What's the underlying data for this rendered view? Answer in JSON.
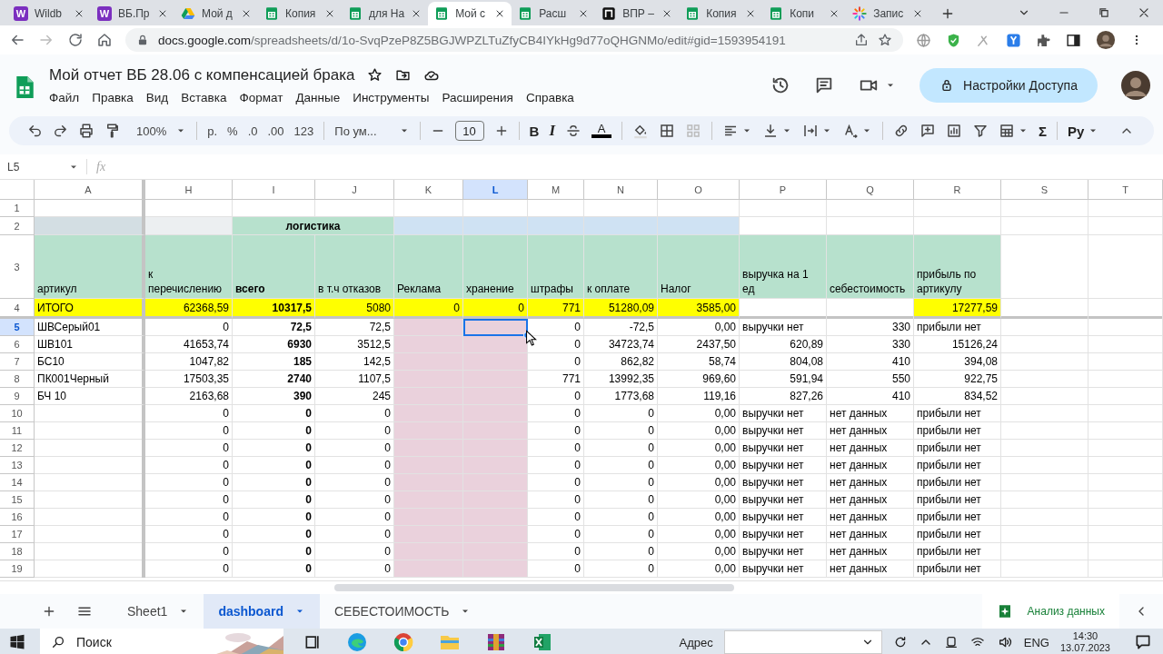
{
  "browser": {
    "tabs": [
      {
        "title": "Wildb",
        "kind": "badge",
        "badge": "W",
        "selected": false
      },
      {
        "title": "ВБ.Пр",
        "kind": "badge",
        "badge": "W",
        "selected": false
      },
      {
        "title": "Мой д",
        "kind": "drive",
        "selected": false
      },
      {
        "title": "Копия",
        "kind": "sheets",
        "selected": false
      },
      {
        "title": "для На",
        "kind": "sheets",
        "selected": false
      },
      {
        "title": "Мой с",
        "kind": "sheets",
        "selected": true
      },
      {
        "title": "Расш",
        "kind": "sheets",
        "selected": false
      },
      {
        "title": "ВПР –",
        "kind": "dark",
        "selected": false
      },
      {
        "title": "Копия",
        "kind": "sheets",
        "selected": false
      },
      {
        "title": "Копи",
        "kind": "sheets",
        "selected": false
      },
      {
        "title": "Запис",
        "kind": "spinner",
        "selected": false
      }
    ],
    "url_host": "docs.google.com",
    "url_path": "/spreadsheets/d/1o-SvqPzeP8Z5BGJWPZLTuZfyCB4IYkHg9d77oQHGNMo/edit#gid=1593954191"
  },
  "doc": {
    "title": "Мой отчет ВБ 28.06 с компенсацией брака",
    "menu": [
      "Файл",
      "Правка",
      "Вид",
      "Вставка",
      "Формат",
      "Данные",
      "Инструменты",
      "Расширения",
      "Справка"
    ],
    "share": "Настройки Доступа"
  },
  "toolbar": {
    "zoom": "100%",
    "currency": "р.",
    "percent": "%",
    "decrease_decimals": ".0",
    "increase_decimals": ".00",
    "number_format": "123",
    "font": "По ум...",
    "font_size": "10",
    "bold": "B",
    "italic": "I",
    "text_color": "A",
    "sum": "Σ",
    "input_tools": "Ру"
  },
  "formula_bar": {
    "cell": "L5",
    "fx": "fx"
  },
  "sheet": {
    "columns": [
      {
        "label": "A",
        "selected": false,
        "bold": false
      },
      {
        "label": "H",
        "selected": false,
        "bold": false
      },
      {
        "label": "I",
        "selected": false,
        "bold": true
      },
      {
        "label": "J",
        "selected": false,
        "bold": false
      },
      {
        "label": "K",
        "selected": false,
        "bold": false
      },
      {
        "label": "L",
        "selected": true,
        "bold": false
      },
      {
        "label": "M",
        "selected": false,
        "bold": false
      },
      {
        "label": "N",
        "selected": false,
        "bold": false
      },
      {
        "label": "O",
        "selected": false,
        "bold": false
      },
      {
        "label": "P",
        "selected": false,
        "bold": false
      },
      {
        "label": "Q",
        "selected": false,
        "bold": false
      },
      {
        "label": "R",
        "selected": false,
        "bold": false
      },
      {
        "label": "S",
        "selected": false
      },
      {
        "label": "T",
        "selected": false
      }
    ],
    "rows": [
      {
        "number": "1",
        "selected": false,
        "cells": {}
      },
      {
        "number": "2",
        "selected": false,
        "cells": {
          "A": {
            "color": "#d3dee3"
          },
          "H": {
            "color": "#eceff1"
          },
          "I": {
            "text": "логистика",
            "color": "#b7e1cd",
            "merged": true
          },
          "K": {
            "color": "#cfe2f3"
          },
          "L": {
            "color": "#cfe2f3"
          },
          "M": {
            "color": "#cfe2f3"
          },
          "N": {
            "color": "#cfe2f3"
          },
          "O": {
            "color": "#cfe2f3"
          }
        }
      },
      {
        "number": "3",
        "selected": false,
        "cells": {
          "A": {
            "text": "артикул",
            "color": "#b7e1cd"
          },
          "H": {
            "text": "к перечислению",
            "color": "#b7e1cd"
          },
          "I": {
            "text": "всего",
            "color": "#b7e1cd"
          },
          "J": {
            "text": "в т.ч отказов",
            "color": "#b7e1cd"
          },
          "K": {
            "text": "Реклама",
            "color": "#b7e1cd"
          },
          "L": {
            "text": "хранение",
            "color": "#b7e1cd"
          },
          "M": {
            "text": "штрафы",
            "color": "#b7e1cd"
          },
          "N": {
            "text": "к оплате",
            "color": "#b7e1cd"
          },
          "O": {
            "text": "Налог",
            "color": "#b7e1cd"
          },
          "P": {
            "text": "выручка на 1 ед",
            "color": "#b7e1cd"
          },
          "Q": {
            "text": "себестоимость",
            "color": "#b7e1cd"
          },
          "R": {
            "text": "прибыль по артикулу",
            "color": "#b7e1cd"
          }
        }
      },
      {
        "number": "4",
        "selected": false,
        "cells": {
          "A": {
            "text": "ИТОГО",
            "color": "#ffff00"
          },
          "H": {
            "text": "62368,59",
            "color": "#ffff00"
          },
          "I": {
            "text": "10317,5",
            "color": "#ffff00"
          },
          "J": {
            "text": "5080",
            "color": "#ffff00"
          },
          "K": {
            "text": "0",
            "color": "#ffff00"
          },
          "L": {
            "text": "0",
            "color": "#ffff00"
          },
          "M": {
            "text": "771",
            "color": "#ffff00"
          },
          "N": {
            "text": "51280,09",
            "color": "#ffff00"
          },
          "O": {
            "text": "3585,00",
            "color": "#ffff00"
          },
          "R": {
            "text": "17277,59",
            "color": "#ffff00"
          }
        }
      },
      {
        "number": "5",
        "selected": true,
        "cells": {
          "A": "ШВСерый01",
          "H": "0",
          "I": "72,5",
          "J": "72,5",
          "K": {
            "color": "#ead1dc"
          },
          "L": {
            "color": "#ead1dc",
            "selected": true
          },
          "M": "0",
          "N": "-72,5",
          "O": "0,00",
          "P": "выручки нет",
          "Q": "330",
          "R": "прибыли нет"
        }
      },
      {
        "number": "6",
        "selected": false,
        "cells": {
          "A": "ШВ101",
          "H": "41653,74",
          "I": "6930",
          "J": "3512,5",
          "K": {
            "color": "#ead1dc"
          },
          "L": {
            "color": "#ead1dc"
          },
          "M": "0",
          "N": "34723,74",
          "O": "2437,50",
          "P": "620,89",
          "Q": "330",
          "R": "15126,24"
        }
      },
      {
        "number": "7",
        "selected": false,
        "cells": {
          "A": "БС10",
          "H": "1047,82",
          "I": "185",
          "J": "142,5",
          "K": {
            "color": "#ead1dc"
          },
          "L": {
            "color": "#ead1dc"
          },
          "M": "0",
          "N": "862,82",
          "O": "58,74",
          "P": "804,08",
          "Q": "410",
          "R": "394,08"
        }
      },
      {
        "number": "8",
        "selected": false,
        "cells": {
          "A": "ПК001Черный",
          "H": "17503,35",
          "I": "2740",
          "J": "1107,5",
          "K": {
            "color": "#ead1dc"
          },
          "L": {
            "color": "#ead1dc"
          },
          "M": "771",
          "N": "13992,35",
          "O": "969,60",
          "P": "591,94",
          "Q": "550",
          "R": "922,75"
        }
      },
      {
        "number": "9",
        "selected": false,
        "cells": {
          "A": "БЧ 10",
          "H": "2163,68",
          "I": "390",
          "J": "245",
          "K": {
            "color": "#ead1dc"
          },
          "L": {
            "color": "#ead1dc"
          },
          "M": "0",
          "N": "1773,68",
          "O": "119,16",
          "P": "827,26",
          "Q": "410",
          "R": "834,52"
        }
      },
      {
        "number": "10",
        "selected": false,
        "cells": {
          "H": "0",
          "I": "0",
          "J": "0",
          "K": {
            "color": "#ead1dc"
          },
          "L": {
            "color": "#ead1dc"
          },
          "M": "0",
          "N": "0",
          "O": "0,00",
          "P": "выручки нет",
          "Q": "нет данных",
          "R": "прибыли нет"
        }
      },
      {
        "number": "11",
        "selected": false,
        "cells": {
          "H": "0",
          "I": "0",
          "J": "0",
          "K": {
            "color": "#ead1dc"
          },
          "L": {
            "color": "#ead1dc"
          },
          "M": "0",
          "N": "0",
          "O": "0,00",
          "P": "выручки нет",
          "Q": "нет данных",
          "R": "прибыли нет"
        }
      },
      {
        "number": "12",
        "selected": false,
        "cells": {
          "H": "0",
          "I": "0",
          "J": "0",
          "K": {
            "color": "#ead1dc"
          },
          "L": {
            "color": "#ead1dc"
          },
          "M": "0",
          "N": "0",
          "O": "0,00",
          "P": "выручки нет",
          "Q": "нет данных",
          "R": "прибыли нет"
        }
      },
      {
        "number": "13",
        "selected": false,
        "cells": {
          "H": "0",
          "I": "0",
          "J": "0",
          "K": {
            "color": "#ead1dc"
          },
          "L": {
            "color": "#ead1dc"
          },
          "M": "0",
          "N": "0",
          "O": "0,00",
          "P": "выручки нет",
          "Q": "нет данных",
          "R": "прибыли нет"
        }
      },
      {
        "number": "14",
        "selected": false,
        "cells": {
          "H": "0",
          "I": "0",
          "J": "0",
          "K": {
            "color": "#ead1dc"
          },
          "L": {
            "color": "#ead1dc"
          },
          "M": "0",
          "N": "0",
          "O": "0,00",
          "P": "выручки нет",
          "Q": "нет данных",
          "R": "прибыли нет"
        }
      },
      {
        "number": "15",
        "selected": false,
        "cells": {
          "H": "0",
          "I": "0",
          "J": "0",
          "K": {
            "color": "#ead1dc"
          },
          "L": {
            "color": "#ead1dc"
          },
          "M": "0",
          "N": "0",
          "O": "0,00",
          "P": "выручки нет",
          "Q": "нет данных",
          "R": "прибыли нет"
        }
      },
      {
        "number": "16",
        "selected": false,
        "cells": {
          "H": "0",
          "I": "0",
          "J": "0",
          "K": {
            "color": "#ead1dc"
          },
          "L": {
            "color": "#ead1dc"
          },
          "M": "0",
          "N": "0",
          "O": "0,00",
          "P": "выручки нет",
          "Q": "нет данных",
          "R": "прибыли нет"
        }
      },
      {
        "number": "17",
        "selected": false,
        "cells": {
          "H": "0",
          "I": "0",
          "J": "0",
          "K": {
            "color": "#ead1dc"
          },
          "L": {
            "color": "#ead1dc"
          },
          "M": "0",
          "N": "0",
          "O": "0,00",
          "P": "выручки нет",
          "Q": "нет данных",
          "R": "прибыли нет"
        }
      },
      {
        "number": "18",
        "selected": false,
        "cells": {
          "H": "0",
          "I": "0",
          "J": "0",
          "K": {
            "color": "#ead1dc"
          },
          "L": {
            "color": "#ead1dc"
          },
          "M": "0",
          "N": "0",
          "O": "0,00",
          "P": "выручки нет",
          "Q": "нет данных",
          "R": "прибыли нет"
        }
      },
      {
        "number": "19",
        "selected": false,
        "cells": {
          "H": "0",
          "I": "0",
          "J": "0",
          "K": {
            "color": "#ead1dc"
          },
          "L": {
            "color": "#ead1dc"
          },
          "M": "0",
          "N": "0",
          "O": "0,00",
          "P": "выручки нет",
          "Q": "нет данных",
          "R": "прибыли нет"
        }
      }
    ]
  },
  "sheet_tabs": [
    {
      "label": "Sheet1",
      "selected": false
    },
    {
      "label": "dashboard",
      "selected": true
    },
    {
      "label": "СЕБЕСТОИМОСТЬ",
      "selected": false
    }
  ],
  "explore": "Анализ данных",
  "taskbar": {
    "search": "Поиск",
    "address_label": "Адрес",
    "language": "ENG",
    "time": "14:30",
    "date": "13.07.2023"
  }
}
